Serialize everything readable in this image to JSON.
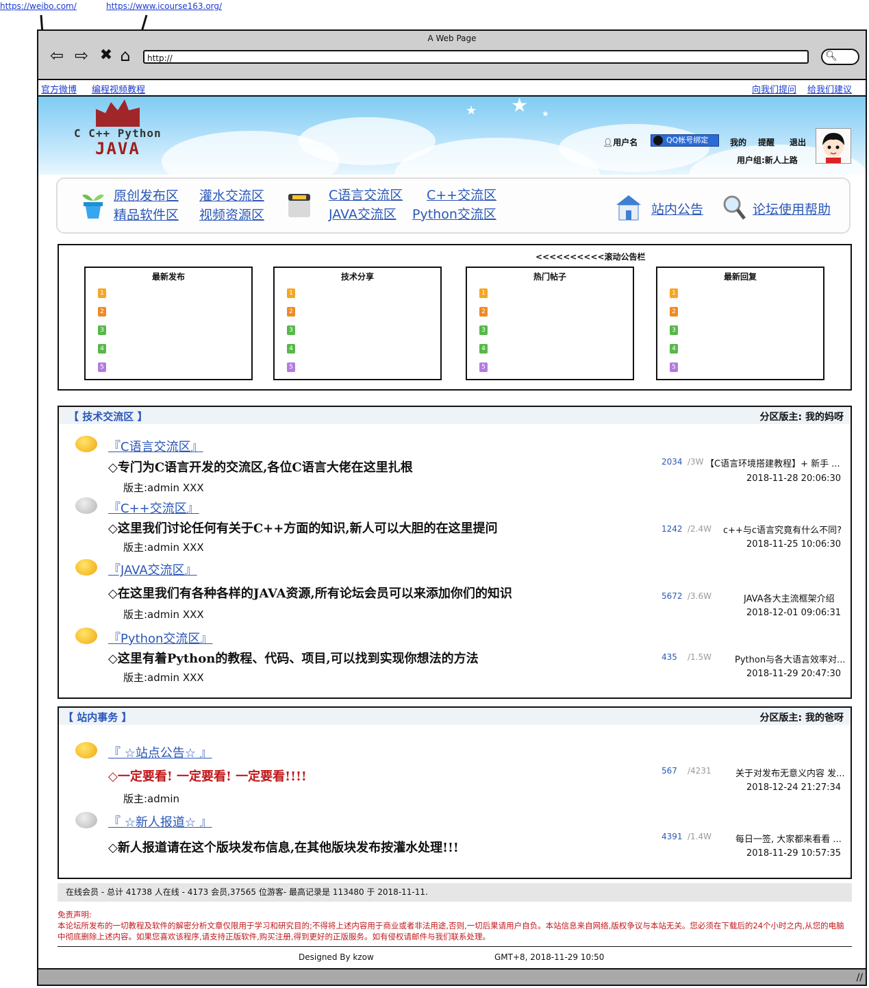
{
  "annotations": {
    "weibo_url": "https://weibo.com/",
    "icourse_url": "https://www.icourse163.org/"
  },
  "browser": {
    "title": "A Web Page",
    "url": "http://"
  },
  "linkbar": {
    "left": [
      "官方微博",
      "编程视频教程"
    ],
    "right": [
      "向我们提问",
      "给我们建议"
    ]
  },
  "logo": {
    "line1": "C C++ Python",
    "line2": "JAVA"
  },
  "user": {
    "username": "用户名",
    "qq_bind": "QQ帐号绑定",
    "mine": "我的",
    "remind": "提醒",
    "logout": "退出",
    "group": "用户组:新人上路"
  },
  "nav": {
    "group1": [
      "原创发布区",
      "灌水交流区",
      "精品软件区",
      "视频资源区"
    ],
    "group2": [
      "C语言交流区",
      "C++交流区",
      "JAVA交流区",
      "Python交流区"
    ],
    "announce": "站内公告",
    "help": "论坛使用帮助"
  },
  "scroll": {
    "title": "<<<<<<<<<<滚动公告栏",
    "columns": [
      "最新发布",
      "技术分享",
      "热门帖子",
      "最新回复"
    ],
    "ranks": [
      "1",
      "2",
      "3",
      "4",
      "5"
    ]
  },
  "colors": {
    "rank1": "#f5a623",
    "rank2": "#f08a24",
    "rank3": "#58b84a",
    "rank4": "#58b84a",
    "rank5": "#b57be0",
    "link_blue": "#2a57b8",
    "disclaimer_red": "#c0171a"
  },
  "tech_section": {
    "title": "【 技术交流区 】",
    "moderator": "分区版主:  我的妈呀",
    "forums": [
      {
        "title": "『C语言交流区』",
        "desc": "◇专门为C语言开发的交流区,各位C语言大佬在这里扎根",
        "mod": "版主:admin  XXX",
        "threads": "2034",
        "posts": "/3W",
        "last": "【C语言环境搭建教程】+ 新手 ...",
        "date": "2018-11-28 20:06:30",
        "icon": "yellow"
      },
      {
        "title": "『C++交流区』",
        "desc": "◇这里我们讨论任何有关于C++方面的知识,新人可以大胆的在这里提问",
        "mod": "版主:admin  XXX",
        "threads": "1242",
        "posts": "/2.4W",
        "last": "c++与c语言究竟有什么不同?",
        "date": "2018-11-25 10:06:30",
        "icon": "gray"
      },
      {
        "title": "『JAVA交流区』",
        "desc": "◇在这里我们有各种各样的JAVA资源,所有论坛会员可以来添加你们的知识",
        "mod": "版主:admin  XXX",
        "threads": "5672",
        "posts": "/3.6W",
        "last": "JAVA各大主流框架介绍",
        "date": "2018-12-01 09:06:31",
        "icon": "yellow"
      },
      {
        "title": "『Python交流区』",
        "desc": "◇这里有着Python的教程、代码、项目,可以找到实现你想法的方法",
        "mod": "版主:admin  XXX",
        "threads": "435",
        "posts": "/1.5W",
        "last": "Python与各大语言效率对...",
        "date": "2018-11-29 20:47:30",
        "icon": "yellow"
      }
    ]
  },
  "affairs_section": {
    "title": "【 站内事务 】",
    "moderator": "分区版主:  我的爸呀",
    "forums": [
      {
        "title": "『 ☆站点公告☆ 』",
        "desc": "◇一定要看!  一定要看!  一定要看!!!!",
        "mod": "版主:admin",
        "threads": "567",
        "posts": "/4231",
        "last": "关于对发布无意义内容 发...",
        "date": "2018-12-24 21:27:34",
        "icon": "yellow"
      },
      {
        "title": "『 ☆新人报道☆ 』",
        "desc": "◇新人报道请在这个版块发布信息,在其他版块发布按灌水处理!!!",
        "mod": "",
        "threads": "4391",
        "posts": "/1.4W",
        "last": "每日一签, 大家都来看看 ...",
        "date": "2018-11-29 10:57:35",
        "icon": "gray"
      }
    ]
  },
  "online": "在线会员 - 总计 41738 人在线 - 4173 会员,37565 位游客- 最高记录是 113480 于 2018-11-11.",
  "disclaimer": {
    "title": "免责声明:",
    "text": "本论坛所发布的一切教程及软件的解密分析文章仅限用于学习和研究目的;不得将上述内容用于商业或者非法用途,否则,一切后果请用户自负。本站信息来自网络,版权争议与本站无关。您必须在下载后的24个小时之内,从您的电脑中彻底删除上述内容。如果您喜欢该程序,请支持正版软件,购买注册,得到更好的正版服务。如有侵权请邮件与我们联系处理。"
  },
  "footer": {
    "designed": "Designed By kzow",
    "time": "GMT+8, 2018-11-29 10:50"
  }
}
